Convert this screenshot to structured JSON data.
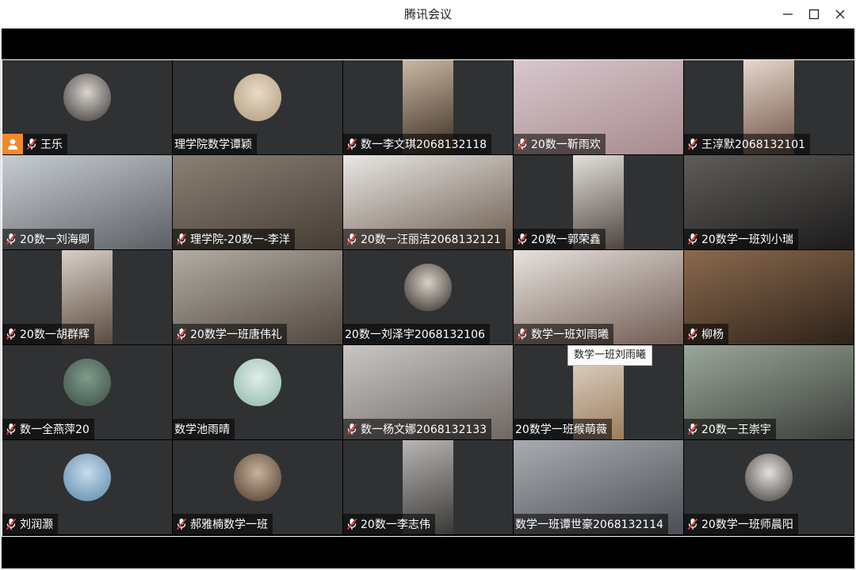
{
  "window": {
    "title": "腾讯会议"
  },
  "tiles": [
    {
      "name": "王乐",
      "host": true,
      "mic": true,
      "kind": "avatar",
      "colors": [
        "#d9d4cf",
        "#3a3431"
      ]
    },
    {
      "name": "理学院数学谭颖",
      "host": false,
      "mic": false,
      "kind": "avatar",
      "colors": [
        "#e8dcc9",
        "#b19a78"
      ]
    },
    {
      "name": "数一李文琪2068132118",
      "host": false,
      "mic": true,
      "kind": "narrow",
      "colors": [
        "#c9b8a4",
        "#3b2d22"
      ]
    },
    {
      "name": "20数一靳雨欢",
      "host": false,
      "mic": true,
      "kind": "full",
      "colors": [
        "#d7c7cc",
        "#a78a8e"
      ]
    },
    {
      "name": "王淳默2068132101",
      "host": false,
      "mic": true,
      "kind": "narrow",
      "colors": [
        "#e6d6cc",
        "#6e5446"
      ]
    },
    {
      "name": "20数一刘海卿",
      "host": false,
      "mic": true,
      "kind": "full",
      "colors": [
        "#c7cdd3",
        "#5c5f63"
      ]
    },
    {
      "name": "理学院-20数一-李洋",
      "host": false,
      "mic": true,
      "kind": "full",
      "colors": [
        "#8a8176",
        "#453c33"
      ]
    },
    {
      "name": "20数一汪丽洁2068132121",
      "host": false,
      "mic": true,
      "kind": "full",
      "colors": [
        "#e9e7e4",
        "#6b5a4d"
      ]
    },
    {
      "name": "20数一郭荣鑫",
      "host": false,
      "mic": true,
      "kind": "narrow",
      "colors": [
        "#e3e0dc",
        "#4e443d"
      ]
    },
    {
      "name": "20数学一班刘小瑞",
      "host": false,
      "mic": true,
      "kind": "full",
      "colors": [
        "#5f5d5b",
        "#1c1b1a"
      ]
    },
    {
      "name": "20数一胡群辉",
      "host": false,
      "mic": true,
      "kind": "narrow",
      "colors": [
        "#d8cfc7",
        "#5b4a3e"
      ]
    },
    {
      "name": "20数学一班唐伟礼",
      "host": false,
      "mic": true,
      "kind": "full",
      "colors": [
        "#b3aca4",
        "#50473f"
      ]
    },
    {
      "name": "20数一刘泽宇2068132106",
      "host": false,
      "mic": false,
      "kind": "avatar",
      "colors": [
        "#d8d1c6",
        "#2e2a26"
      ]
    },
    {
      "name": "数学一班刘雨曦",
      "host": false,
      "mic": true,
      "kind": "full",
      "colors": [
        "#e8e2dd",
        "#6f5b52"
      ]
    },
    {
      "name": "柳杨",
      "host": false,
      "mic": true,
      "kind": "full",
      "colors": [
        "#8a6a4e",
        "#2e2219"
      ]
    },
    {
      "name": "数一全燕萍20",
      "host": false,
      "mic": true,
      "kind": "avatar",
      "colors": [
        "#7e9b8a",
        "#3c4e45"
      ]
    },
    {
      "name": "数学池雨晴",
      "host": false,
      "mic": false,
      "kind": "avatar",
      "colors": [
        "#dfeee8",
        "#8fb7a7"
      ]
    },
    {
      "name": "数一杨文娜2068132133",
      "host": false,
      "mic": true,
      "kind": "full",
      "colors": [
        "#c8c6c4",
        "#6e6762"
      ]
    },
    {
      "name": "20数学一班缑萌薇",
      "host": false,
      "mic": false,
      "kind": "narrow",
      "colors": [
        "#e4dccf",
        "#9c7c5c"
      ]
    },
    {
      "name": "20数一王崇宇",
      "host": false,
      "mic": true,
      "kind": "full",
      "colors": [
        "#9aa79b",
        "#3b3f39"
      ]
    },
    {
      "name": "刘润灏",
      "host": false,
      "mic": true,
      "kind": "avatar",
      "colors": [
        "#c7dcec",
        "#5b86a7"
      ]
    },
    {
      "name": "郝雅楠数学一班",
      "host": false,
      "mic": true,
      "kind": "avatar",
      "colors": [
        "#c9b29a",
        "#4a3a2c"
      ]
    },
    {
      "name": "20数一李志伟",
      "host": false,
      "mic": true,
      "kind": "narrow",
      "colors": [
        "#b8b6b4",
        "#3a3836"
      ]
    },
    {
      "name": "数学一班谭世豪2068132114",
      "host": false,
      "mic": false,
      "kind": "full",
      "colors": [
        "#a9acb1",
        "#4b4e54"
      ]
    },
    {
      "name": "20数学一班师晨阳",
      "host": false,
      "mic": true,
      "kind": "avatar",
      "colors": [
        "#e4e2df",
        "#3e3a36"
      ]
    }
  ],
  "tooltip": {
    "text": "数学一班刘雨曦"
  },
  "colors": {
    "tile_bg": "#2f3133",
    "host_badge": "#f08a2c",
    "label_bg": "rgba(0,0,0,0.55)"
  },
  "icons": {
    "mic": "microphone-muted-icon",
    "host": "host-user-icon",
    "minimize": "minimize-icon",
    "maximize": "maximize-icon",
    "close": "close-icon"
  }
}
